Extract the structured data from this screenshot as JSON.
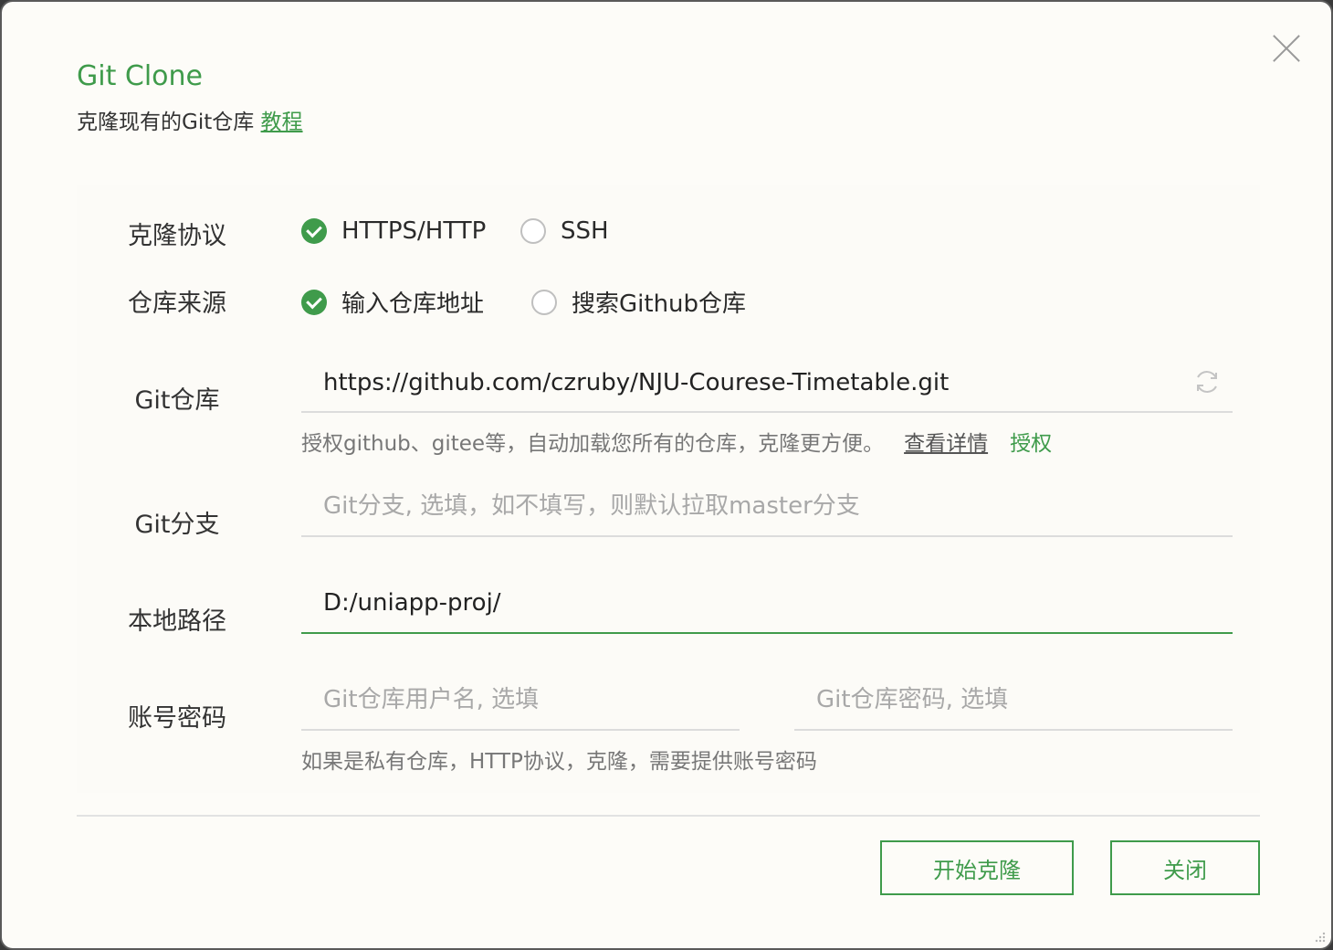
{
  "dialog": {
    "title": "Git Clone",
    "subtitle": "克隆现有的Git仓库",
    "tutorial_link": "教程"
  },
  "protocol": {
    "label": "克隆协议",
    "options": [
      "HTTPS/HTTP",
      "SSH"
    ],
    "selected": "HTTPS/HTTP"
  },
  "source": {
    "label": "仓库来源",
    "options": [
      "输入仓库地址",
      "搜索Github仓库"
    ],
    "selected": "输入仓库地址"
  },
  "repo": {
    "label": "Git仓库",
    "value": "https://github.com/czruby/NJU-Courese-Timetable.git",
    "hint": "授权github、gitee等，自动加载您所有的仓库，克隆更方便。",
    "details_link": "查看详情",
    "authorize_link": "授权"
  },
  "branch": {
    "label": "Git分支",
    "value": "",
    "placeholder": "Git分支, 选填，如不填写，则默认拉取master分支"
  },
  "local_path": {
    "label": "本地路径",
    "value": "D:/uniapp-proj/"
  },
  "account": {
    "label": "账号密码",
    "username_placeholder": "Git仓库用户名, 选填",
    "password_placeholder": "Git仓库密码, 选填",
    "hint": "如果是私有仓库，HTTP协议，克隆，需要提供账号密码"
  },
  "buttons": {
    "start_clone": "开始克隆",
    "close": "关闭"
  },
  "colors": {
    "accent": "#3f9b4b",
    "background": "#fdfcf8"
  },
  "icons": [
    "close-icon",
    "refresh-icon",
    "check-icon",
    "resize-grip-icon"
  ]
}
